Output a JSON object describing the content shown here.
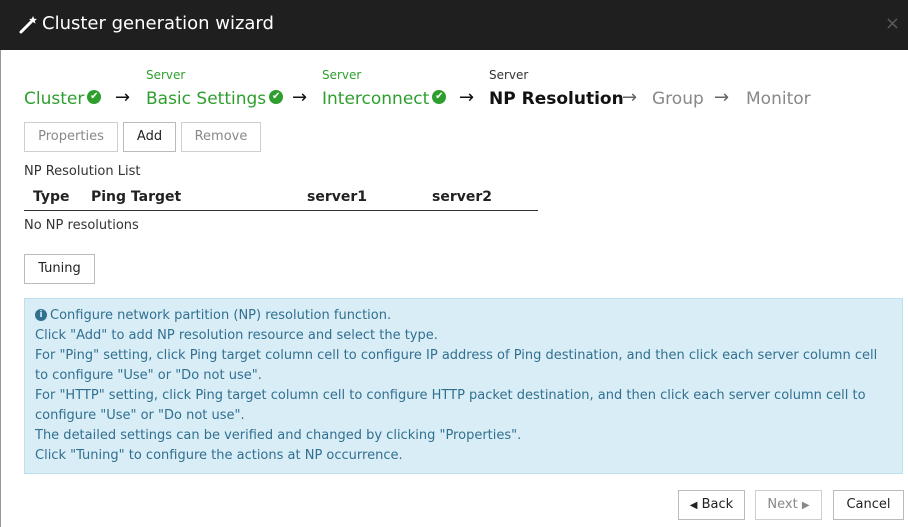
{
  "window": {
    "title": "Cluster generation wizard",
    "icon": "magic-wand-icon",
    "close_label": "×"
  },
  "steps": [
    {
      "sub": "",
      "label": "Cluster",
      "state": "done"
    },
    {
      "sub": "Server",
      "label": "Basic Settings",
      "state": "done"
    },
    {
      "sub": "Server",
      "label": "Interconnect",
      "state": "done"
    },
    {
      "sub": "Server",
      "label": "NP Resolution",
      "state": "current"
    },
    {
      "sub": "",
      "label": "Group",
      "state": "future"
    },
    {
      "sub": "",
      "label": "Monitor",
      "state": "future"
    }
  ],
  "toolbar": {
    "properties": "Properties",
    "add": "Add",
    "remove": "Remove"
  },
  "np_list": {
    "title": "NP Resolution List",
    "columns": [
      "Type",
      "Ping Target",
      "server1",
      "server2"
    ],
    "empty_text": "No NP resolutions"
  },
  "tuning_label": "Tuning",
  "info": {
    "lines": [
      "Configure network partition (NP) resolution function.",
      "Click \"Add\" to add NP resolution resource and select the type.",
      "For \"Ping\" setting, click Ping target column cell to configure IP address of Ping destination, and then click each server column cell to configure \"Use\" or \"Do not use\".",
      "For \"HTTP\" setting, click Ping target column cell to configure HTTP packet destination, and then click each server column cell to configure \"Use\" or \"Do not use\".",
      "The detailed settings can be verified and changed by clicking \"Properties\".",
      "Click \"Tuning\" to configure the actions at NP occurrence."
    ]
  },
  "footer": {
    "back": "Back",
    "next": "Next",
    "cancel": "Cancel"
  },
  "colors": {
    "accent_green": "#2e9f2e",
    "info_bg": "#d9edf7",
    "info_text": "#31708f",
    "titlebar": "#1f1f1f"
  }
}
